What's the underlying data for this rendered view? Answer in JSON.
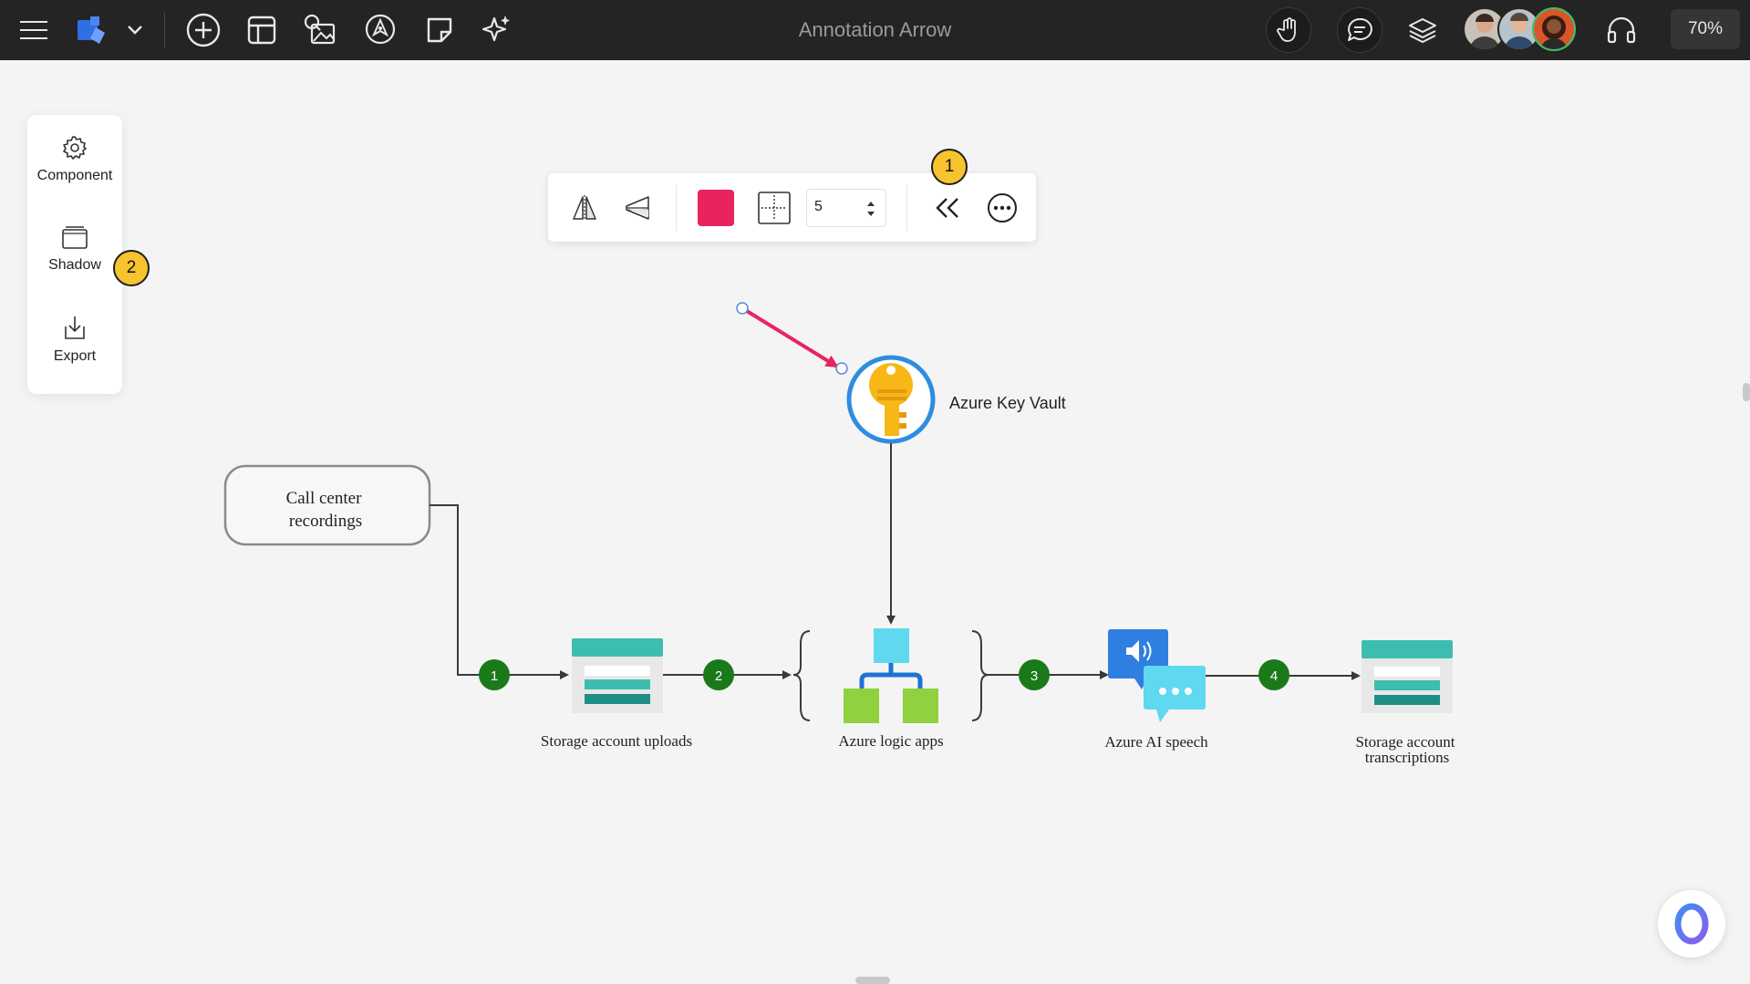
{
  "header": {
    "title": "Annotation Arrow",
    "zoom": "70%",
    "icons": [
      "menu-icon",
      "app-logo-icon",
      "chevron-down-icon",
      "add-circle-icon",
      "template-icon",
      "image-search-icon",
      "pen-icon",
      "sticky-note-icon",
      "ai-sparkle-icon",
      "hand-icon",
      "comment-icon",
      "layers-icon",
      "headset-icon"
    ],
    "avatars_count": 3
  },
  "sidepanel": {
    "items": [
      {
        "label": "Component",
        "icon": "gear-icon"
      },
      {
        "label": "Shadow",
        "icon": "shadow-icon"
      },
      {
        "label": "Export",
        "icon": "export-icon"
      }
    ]
  },
  "callouts": {
    "one": "1",
    "two": "2"
  },
  "toolbar": {
    "color": "#e8245f",
    "stroke_width": "5",
    "icons": [
      "flip-horizontal-icon",
      "flip-vertical-icon",
      "color-swatch",
      "line-style-icon",
      "arrow-head-icon",
      "more-icon"
    ]
  },
  "diagram": {
    "source": {
      "line1": "Call center",
      "line2": "recordings"
    },
    "nodes": {
      "key_vault": "Azure Key Vault",
      "storage_uploads": "Storage account uploads",
      "logic_apps": "Azure logic apps",
      "ai_speech": "Azure AI speech",
      "storage_transcriptions_1": "Storage account",
      "storage_transcriptions_2": "transcriptions"
    },
    "steps": [
      "1",
      "2",
      "3",
      "4"
    ],
    "arrow_color": "#e8245f",
    "step_color": "#1a7a1a"
  }
}
